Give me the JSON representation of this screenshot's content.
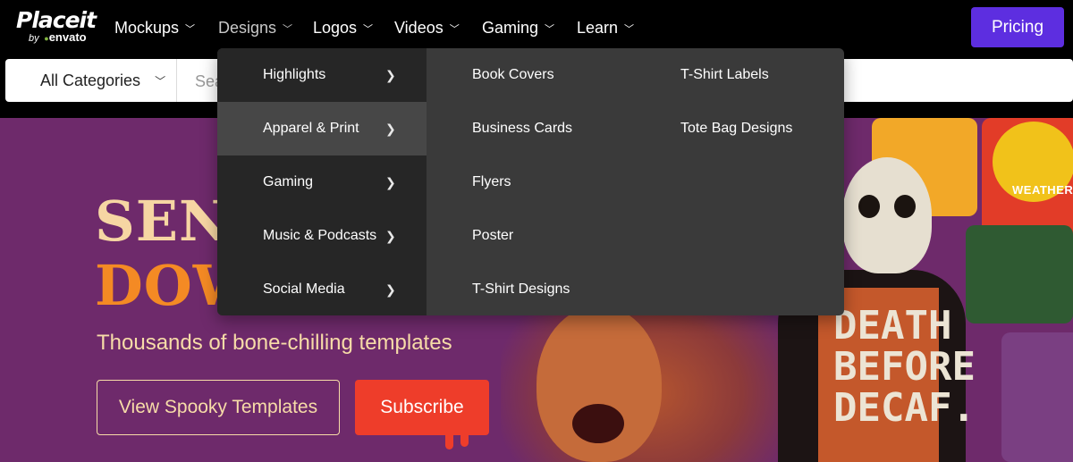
{
  "nav": {
    "logo_main": "Placeit",
    "logo_by": "by",
    "logo_leaf": "●",
    "logo_envato": "envato",
    "items": [
      {
        "label": "Mockups"
      },
      {
        "label": "Designs"
      },
      {
        "label": "Logos"
      },
      {
        "label": "Videos"
      },
      {
        "label": "Gaming"
      },
      {
        "label": "Learn"
      }
    ],
    "chevron": "⌄",
    "pricing_label": "Pricing",
    "accent_color": "#5d2ee0"
  },
  "search": {
    "category_label": "All Categories",
    "placeholder": "Search"
  },
  "dropdown": {
    "categories": [
      {
        "label": "Highlights"
      },
      {
        "label": "Apparel & Print",
        "active": true
      },
      {
        "label": "Gaming"
      },
      {
        "label": "Music & Podcasts"
      },
      {
        "label": "Social Media"
      }
    ],
    "arrow": "›",
    "links": [
      {
        "label": "Book Covers"
      },
      {
        "label": "Business Cards"
      },
      {
        "label": "Flyers"
      },
      {
        "label": "Poster"
      },
      {
        "label": "T-Shirt Designs"
      },
      {
        "label": "T-Shirt Labels"
      },
      {
        "label": "Tote Bag Designs"
      }
    ]
  },
  "hero": {
    "title_line1": "SEND",
    "title_line2": "DOWN",
    "subtitle": "Thousands of bone-chilling templates",
    "view_button": "View Spooky Templates",
    "subscribe_button": "Subscribe",
    "collage_badge": "WEATHER",
    "shirt_text": [
      "DEATH",
      "BEFORE",
      "DECAF."
    ],
    "background_color": "#6e2a6b",
    "subscribe_color": "#ee3d2a"
  }
}
